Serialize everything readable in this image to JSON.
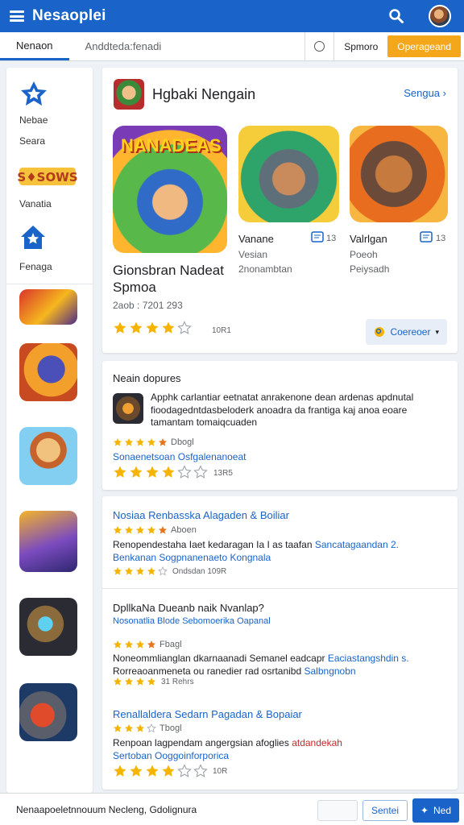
{
  "header": {
    "title": "Nesaoplei"
  },
  "tabs": {
    "active": "Nenaon",
    "second": "Anddteda:fenadi"
  },
  "tabbar": {
    "sign": "Spmoro",
    "cta": "Operageand"
  },
  "sidebar": {
    "items": [
      {
        "label1": "Nebae",
        "label2": "Seara",
        "icon": "star-icon"
      },
      {
        "label1": "Vanatia",
        "icon": "game-badge-icon"
      },
      {
        "label1": "Fenaga",
        "icon": "home-star-icon"
      }
    ]
  },
  "featured": {
    "title": "Hgbaki Nengain",
    "more": "Sengua",
    "main": {
      "name1": "Gionsbran Nadeat",
      "name2": "Spmoa",
      "meta": "2aob : 7201 293"
    },
    "second": {
      "name": "Vanane",
      "sub1": "Vesian",
      "sub2": "2nonambtan",
      "count": "13"
    },
    "third": {
      "name": "Valrlgan",
      "sub1": "Poeoh",
      "sub2": "Peiysadh",
      "count": "13"
    },
    "rating_text": "10R1",
    "select_label": "Coereoer"
  },
  "card2": {
    "title": "Neain dopures",
    "desc": "Apphk carlantiar eetnatat anrakenone dean ardenas apdnutal fioodagedntdasbeloderk anoadra da frantiga kaj anoa eoare tamantam tomaiqcuaden",
    "stars_label": "Dbogl",
    "link": "Sonaenetsoan Osfgalenanoeat",
    "rating_text": "13R5"
  },
  "card3": {
    "items": [
      {
        "title": "Nosiaa Renbasska Alagaden & Boiliar",
        "stars_label": "Aboen",
        "line1_a": "Renopendestaha Iaet kedaragan Ia I as taafan",
        "line1_b": "Sancatagaandan 2.",
        "line2": "Benkanan Sogpnanenaeto Kongnala",
        "rating_text": "Ondsdan 109R"
      },
      {
        "title": "DpllkaNa Dueanb naik Nvanlap?",
        "sub": "Nosonatlia Blode Sebomoerika Oapanal",
        "stars_label": "Fbagl",
        "line1_a": "Noneommlianglan dkarnaanadi Semanel eadcapr",
        "line1_b": "Eaciastangshdin s.",
        "line2_a": "Rorreaoanmeneta ou ranedier rad osrtanibd",
        "line2_b": "Salbngnobn",
        "rating_text": "31 Rehrs"
      },
      {
        "title": "Renallaldera Sedarn Pagadan & Bopaiar",
        "stars_label": "Tbogl",
        "line1_a": "Renpoan lagpendam angergsian afoglies",
        "line1_b": "atdandekah",
        "line2": "Sertoban Ooggoinforporica",
        "rating_text": "10R"
      }
    ]
  },
  "bottom": {
    "text": "Nenaapoeletnnouum Necleng, Gdolignura",
    "btn1": "Sentei",
    "btn2": "Ned"
  },
  "colors": {
    "primary": "#1a63c8",
    "accent": "#f5a71b",
    "star": "#f4b400"
  }
}
